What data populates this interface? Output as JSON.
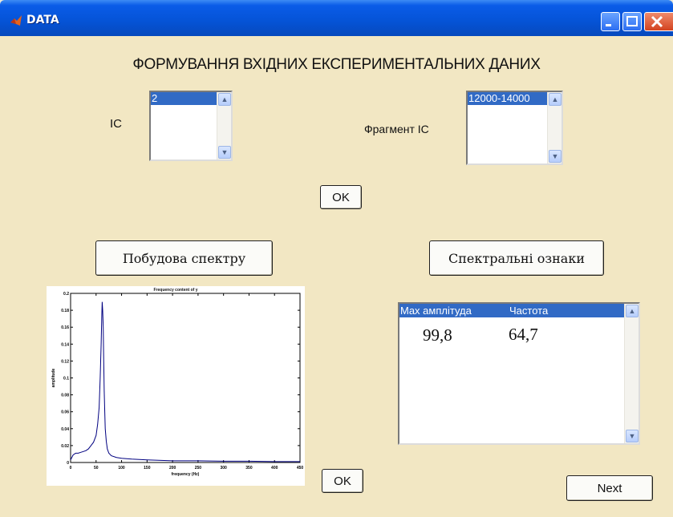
{
  "window": {
    "title": "DATA",
    "colors": {
      "titlebar": "#0553d6",
      "background": "#f2e7c3",
      "selection": "#316ac5"
    }
  },
  "heading": "ФОРМУВАННЯ ВХІДНИХ ЕКСПЕРИМЕНТАЛЬНИХ ДАНИХ",
  "ic": {
    "label": "IC",
    "selected": "2"
  },
  "fragment": {
    "label": "Фрагмент  IC",
    "selected": "12000-14000"
  },
  "buttons": {
    "ok_top": "OK",
    "build_spectrum": "Побудова спектру",
    "spectral_features": "Спектральні ознаки",
    "ok_bottom": "OK",
    "next": "Next"
  },
  "results": {
    "col_amplitude": "Max амплітуда",
    "col_frequency": "Частота",
    "amplitude": "99,8",
    "frequency": "64,7"
  },
  "chart_data": {
    "type": "line",
    "title": "Frequency content of y",
    "xlabel": "frequency (Hz)",
    "ylabel": "amplitude",
    "xlim": [
      0,
      450
    ],
    "ylim": [
      0,
      0.2
    ],
    "x_ticks": [
      "0",
      "50",
      "100",
      "150",
      "200",
      "250",
      "300",
      "350",
      "400",
      "450"
    ],
    "y_ticks": [
      "0",
      "0.02",
      "0.04",
      "0.06",
      "0.08",
      "0.1",
      "0.12",
      "0.14",
      "0.16",
      "0.18",
      "0.2"
    ],
    "series": [
      {
        "color": "#000080",
        "x": [
          0,
          5,
          10,
          15,
          20,
          25,
          30,
          35,
          40,
          45,
          50,
          53,
          56,
          58,
          60,
          61,
          62,
          63,
          64,
          65,
          66,
          67,
          68,
          70,
          72,
          75,
          80,
          90,
          100,
          120,
          150,
          200,
          250,
          300,
          350,
          400,
          450
        ],
        "y": [
          0.003,
          0.009,
          0.011,
          0.011,
          0.012,
          0.013,
          0.014,
          0.016,
          0.02,
          0.024,
          0.032,
          0.045,
          0.065,
          0.1,
          0.14,
          0.17,
          0.19,
          0.18,
          0.16,
          0.12,
          0.085,
          0.06,
          0.04,
          0.025,
          0.016,
          0.011,
          0.008,
          0.006,
          0.005,
          0.004,
          0.003,
          0.002,
          0.002,
          0.0015,
          0.0015,
          0.001,
          0.001
        ]
      }
    ]
  }
}
